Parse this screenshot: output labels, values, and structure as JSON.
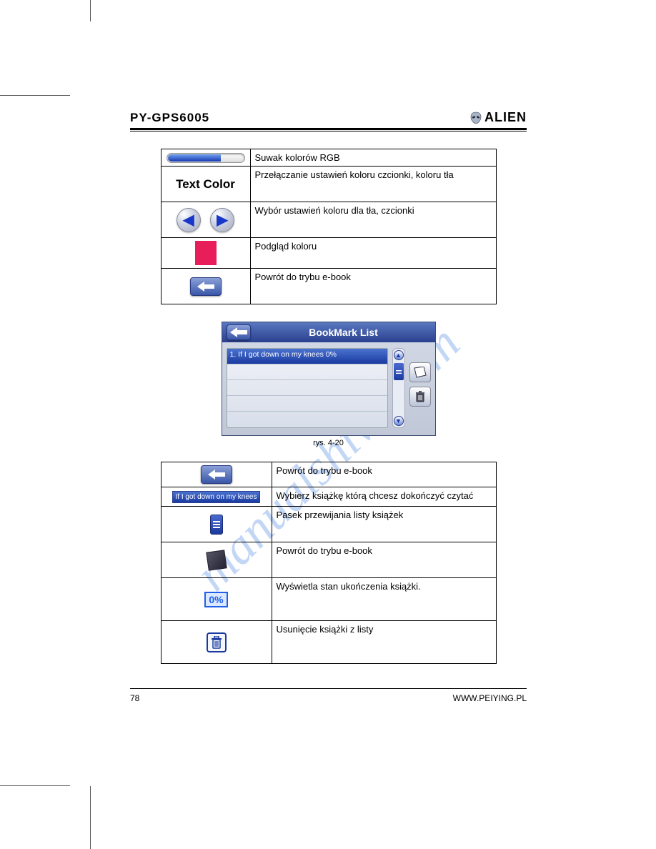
{
  "header": {
    "model": "PY-GPS6005",
    "brand": "ALIEN"
  },
  "table1": {
    "rows": [
      {
        "icon": "slider",
        "desc": "Suwak kolorów RGB"
      },
      {
        "icon": "textcolor",
        "label": "Text Color",
        "desc": "Przełączanie ustawień koloru czcionki, koloru tła"
      },
      {
        "icon": "arrows",
        "desc": "Wybór ustawień koloru dla tła, czcionki"
      },
      {
        "icon": "swatch",
        "desc": "Podgląd koloru"
      },
      {
        "icon": "back",
        "desc": "Powrót do trybu e-book"
      }
    ]
  },
  "screenshot": {
    "title": "BookMark List",
    "row1": "1. If I got down on my knees 0%",
    "caption": "rys. 4-20"
  },
  "table2": {
    "rows": [
      {
        "icon": "back",
        "desc": "Powrót do trybu e-book"
      },
      {
        "icon": "bookmark-strip",
        "label": "If I got down on my knees",
        "desc": "Wybierz książkę którą chcesz dokończyć czytać"
      },
      {
        "icon": "scrollbar",
        "desc": "Pasek przewijania listy książek"
      },
      {
        "icon": "note",
        "desc": "Powrót do trybu e-book"
      },
      {
        "icon": "percent",
        "label": "0%",
        "desc": "Wyświetla stan ukończenia książki."
      },
      {
        "icon": "trash",
        "desc": "Usunięcie książki z listy"
      }
    ]
  },
  "footer": {
    "page": "78",
    "url": "WWW.PEIYING.PL"
  },
  "watermark": "manualshive.com"
}
